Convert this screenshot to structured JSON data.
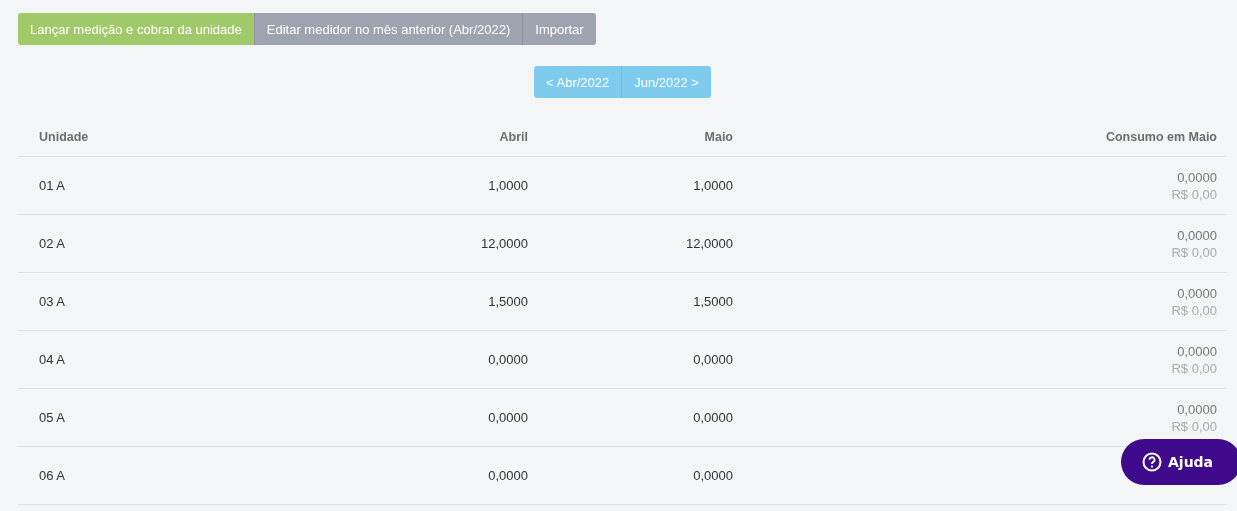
{
  "actions": [
    {
      "label": "Lançar medição e cobrar da unidade",
      "kind": "primary"
    },
    {
      "label": "Editar medidor no mês anterior (Abr/2022)",
      "kind": "secondary"
    },
    {
      "label": "Importar",
      "kind": "secondary"
    }
  ],
  "pagination": {
    "previous": "< Abr/2022",
    "next": "Jun/2022 >"
  },
  "table": {
    "columns": [
      "Unidade",
      "Abril",
      "Maio",
      "Consumo em Maio"
    ],
    "rows": [
      {
        "unit": "01 A",
        "april": "1,0000",
        "may": "1,0000",
        "consumption": "0,0000",
        "cost": "R$ 0,00"
      },
      {
        "unit": "02 A",
        "april": "12,0000",
        "may": "12,0000",
        "consumption": "0,0000",
        "cost": "R$ 0,00"
      },
      {
        "unit": "03 A",
        "april": "1,5000",
        "may": "1,5000",
        "consumption": "0,0000",
        "cost": "R$ 0,00"
      },
      {
        "unit": "04 A",
        "april": "0,0000",
        "may": "0,0000",
        "consumption": "0,0000",
        "cost": "R$ 0,00"
      },
      {
        "unit": "05 A",
        "april": "0,0000",
        "may": "0,0000",
        "consumption": "0,0000",
        "cost": "R$ 0,00"
      },
      {
        "unit": "06 A",
        "april": "0,0000",
        "may": "0,0000"
      }
    ]
  },
  "help_button": {
    "label": "Ajuda"
  }
}
